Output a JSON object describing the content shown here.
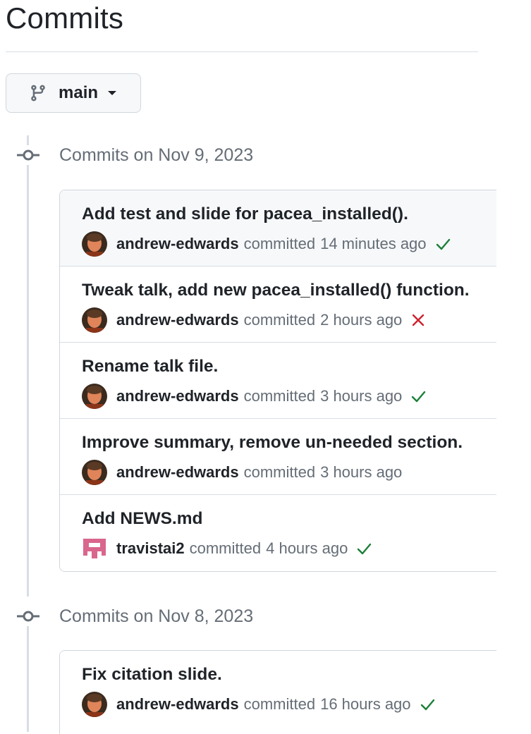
{
  "page": {
    "title": "Commits"
  },
  "branch_selector": {
    "label": "main",
    "icon": "git-branch-icon"
  },
  "colors": {
    "success": "#1a7f37",
    "failure": "#cf222e",
    "muted": "#656d76",
    "border": "#d0d7de"
  },
  "groups": [
    {
      "title": "Commits on Nov 9, 2023",
      "commits": [
        {
          "message": "Add test and slide for pacea_installed().",
          "author": "andrew-edwards",
          "verb": "committed",
          "time": "14 minutes ago",
          "status": "success"
        },
        {
          "message": "Tweak talk, add new pacea_installed() function.",
          "author": "andrew-edwards",
          "verb": "committed",
          "time": "2 hours ago",
          "status": "failure"
        },
        {
          "message": "Rename talk file.",
          "author": "andrew-edwards",
          "verb": "committed",
          "time": "3 hours ago",
          "status": "success"
        },
        {
          "message": "Improve summary, remove un-needed section.",
          "author": "andrew-edwards",
          "verb": "committed",
          "time": "3 hours ago",
          "status": "none"
        },
        {
          "message": "Add NEWS.md",
          "author": "travistai2",
          "verb": "committed",
          "time": "4 hours ago",
          "status": "success"
        }
      ]
    },
    {
      "title": "Commits on Nov 8, 2023",
      "commits": [
        {
          "message": "Fix citation slide.",
          "author": "andrew-edwards",
          "verb": "committed",
          "time": "16 hours ago",
          "status": "success"
        }
      ]
    }
  ]
}
